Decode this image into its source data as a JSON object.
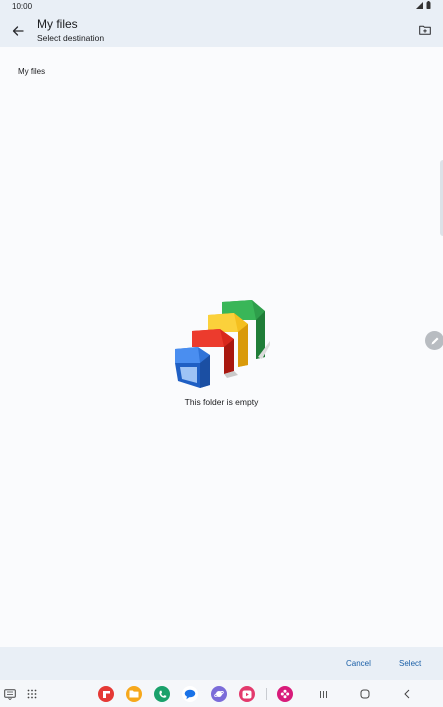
{
  "status_bar": {
    "time": "10:00"
  },
  "header": {
    "title": "My files",
    "subtitle": "Select destination"
  },
  "breadcrumb": {
    "label": "My files"
  },
  "empty_state": {
    "message": "This folder is empty"
  },
  "actions": {
    "cancel_label": "Cancel",
    "select_label": "Select"
  },
  "icons": {
    "back": "arrow-back-icon",
    "new_folder": "create-folder-icon",
    "edit": "pencil-icon",
    "empty": "empty-folders-illustration"
  },
  "nav_apps": [
    {
      "name": "flipboard-app",
      "color": "#e53935"
    },
    {
      "name": "my-files-app",
      "color": "#f6a81c"
    },
    {
      "name": "phone-app",
      "color": "#1aa16b"
    },
    {
      "name": "messages-app",
      "color": "#1a73e8"
    },
    {
      "name": "internet-app",
      "color": "#7b6cd9"
    },
    {
      "name": "video-app",
      "color": "#e33a6d"
    },
    {
      "name": "blossom-app",
      "color": "#d81b7a"
    }
  ],
  "colors": {
    "appbar": "#e9eff6",
    "accent": "#1a5fa7",
    "background": "#fafbfd"
  }
}
